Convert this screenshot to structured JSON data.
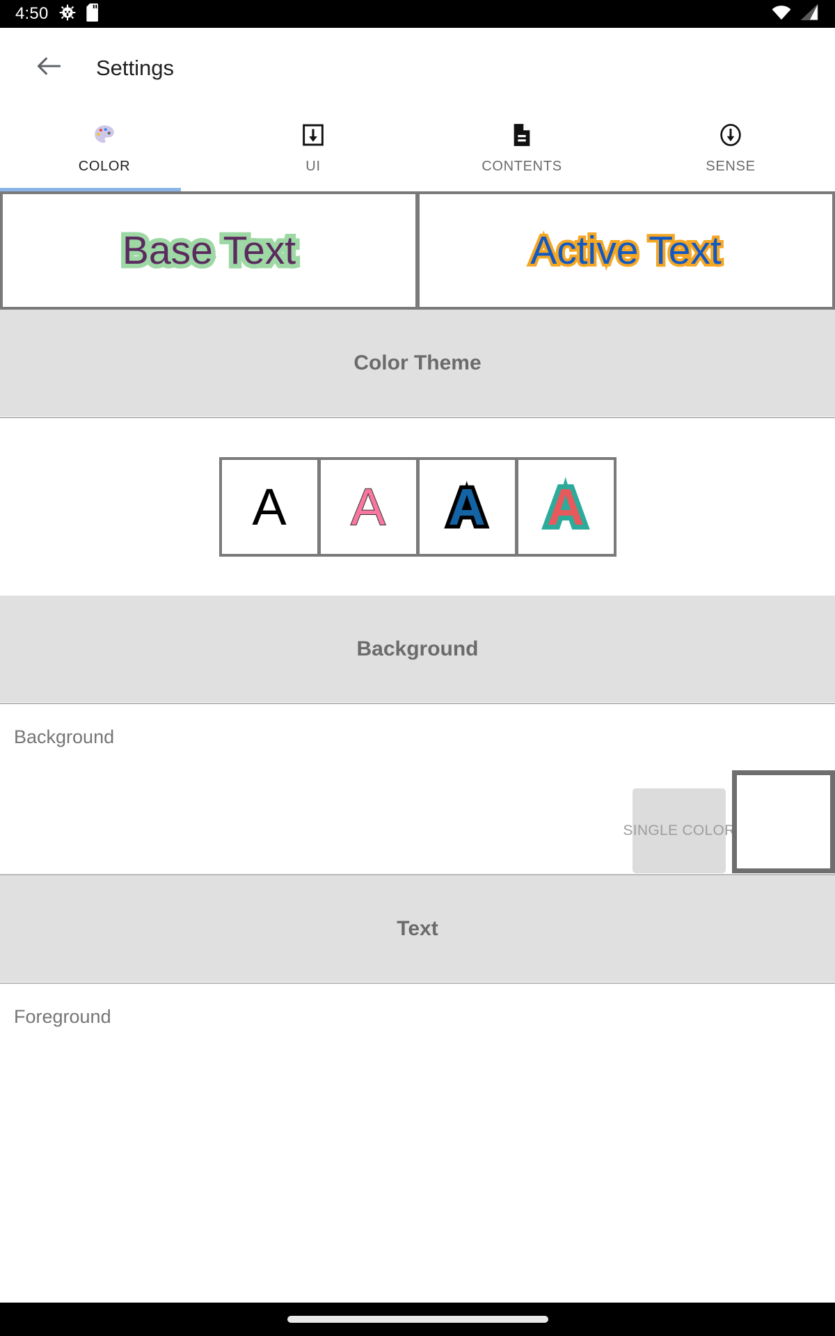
{
  "status_bar": {
    "time": "4:50",
    "left_icons": [
      "android-robot-icon",
      "sd-card-icon"
    ],
    "right_icons": [
      "wifi-icon",
      "cell-signal-icon"
    ]
  },
  "app_bar": {
    "back_icon": "back-arrow-icon",
    "title": "Settings"
  },
  "tabs": {
    "active_index": 0,
    "items": [
      {
        "label": "COLOR",
        "icon": "palette-icon",
        "glyph": "🎨"
      },
      {
        "label": "UI",
        "icon": "download-box-icon",
        "glyph": ""
      },
      {
        "label": "CONTENTS",
        "icon": "document-icon",
        "glyph": ""
      },
      {
        "label": "SENSE",
        "icon": "arrow-down-circle-icon",
        "glyph": ""
      }
    ]
  },
  "preview": {
    "cards": [
      {
        "text": "Base Text",
        "fill": "#5b2a5e",
        "stroke": "#9ed8a5"
      },
      {
        "text": "Active Text",
        "fill": "#1059c4",
        "stroke": "#f5a623"
      }
    ]
  },
  "sections": {
    "color_theme": {
      "title": "Color Theme",
      "swatches": [
        {
          "letter": "A",
          "fill": "#000000",
          "stroke": "none"
        },
        {
          "letter": "A",
          "fill": "#f9779f",
          "stroke": "#333333"
        },
        {
          "letter": "A",
          "fill": "#1464a5",
          "stroke": "#000000"
        },
        {
          "letter": "A",
          "fill": "#e8595b",
          "stroke": "#2cab9b"
        }
      ]
    },
    "background": {
      "title": "Background",
      "row_label": "Background",
      "mode_button": "SINGLE COLOR",
      "color_value": "#ffffff"
    },
    "text": {
      "title": "Text",
      "row_label": "Foreground"
    }
  },
  "nav_bar": {
    "gesture_pill": "home-indicator"
  }
}
